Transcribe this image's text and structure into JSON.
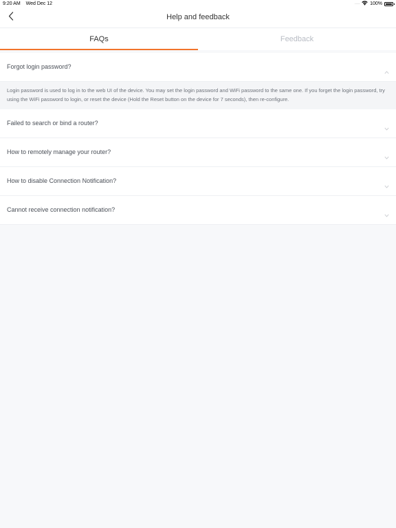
{
  "status_bar": {
    "time": "9:20 AM",
    "date": "Wed Dec 12",
    "battery": "100%"
  },
  "nav": {
    "title": "Help and feedback"
  },
  "tabs": [
    {
      "label": "FAQs",
      "active": true
    },
    {
      "label": "Feedback",
      "active": false
    }
  ],
  "faqs": [
    {
      "question": "Forgot login password?",
      "expanded": true,
      "answer": "Login password is used to log in to the web UI of the device. You may set the login password and WiFi password to the same one. If you forget the login password, try using the WiFi password to login, or reset the device (Hold the Reset button on the device for 7 seconds), then re-configure."
    },
    {
      "question": "Failed to search or bind a router?",
      "expanded": false
    },
    {
      "question": "How to remotely manage your router?",
      "expanded": false
    },
    {
      "question": "How to disable Connection Notification?",
      "expanded": false
    },
    {
      "question": "Cannot receive connection notification?",
      "expanded": false
    }
  ],
  "colors": {
    "accent": "#f2732b",
    "background": "#f7f8fa"
  },
  "icons": {
    "back": "chevron-left-icon",
    "wifi": "wifi-icon",
    "battery": "battery-icon",
    "collapse": "chevron-up-icon",
    "expand": "chevron-down-icon"
  }
}
